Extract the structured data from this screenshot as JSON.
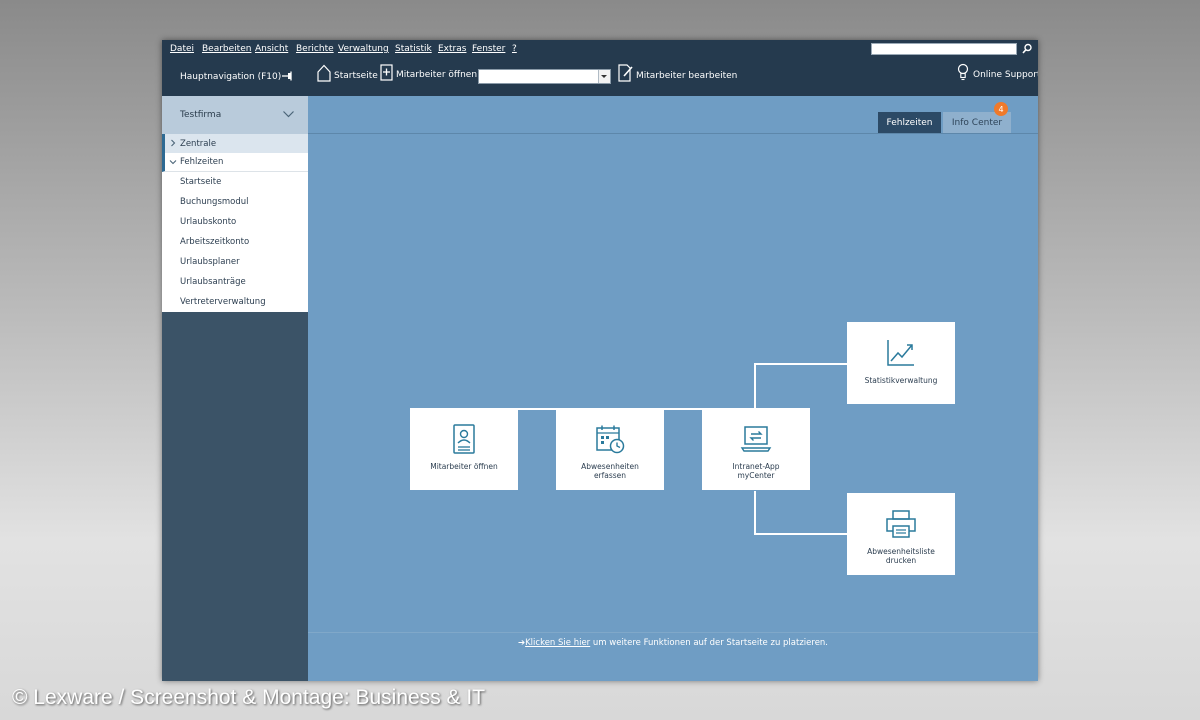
{
  "menubar": {
    "items": [
      "Datei",
      "Bearbeiten",
      "Ansicht",
      "Berichte",
      "Verwaltung",
      "Statistik",
      "Extras",
      "Fenster",
      "?"
    ],
    "search_value": ""
  },
  "toolbar": {
    "nav_label": "Hauptnavigation (F10)",
    "start_label": "Startseite",
    "open_employee_label": "Mitarbeiter öffnen",
    "employee_select_value": "",
    "edit_employee_label": "Mitarbeiter bearbeiten",
    "support_label": "Online Support"
  },
  "sidebar": {
    "company": "Testfirma",
    "sections": [
      "Zentrale",
      "Fehlzeiten"
    ],
    "items": [
      "Startseite",
      "Buchungsmodul",
      "Urlaubskonto",
      "Arbeitszeitkonto",
      "Urlaubsplaner",
      "Urlaubsanträge",
      "Vertreterverwaltung"
    ]
  },
  "tabs": {
    "active": "Fehlzeiten",
    "info": "Info Center",
    "info_badge": "4"
  },
  "tiles": {
    "open_employee": "Mitarbeiter öffnen",
    "record_absences": "Abwesenheiten\nerfassen",
    "intranet_app": "Intranet-App\nmyCenter",
    "statistics": "Statistikverwaltung",
    "print_absences": "Abwesenheitsliste\ndrucken"
  },
  "hint": {
    "link": "Klicken Sie hier",
    "rest": " um weitere Funktionen auf der Startseite zu platzieren."
  },
  "copyright": "© Lexware / Screenshot & Montage: Business & IT",
  "colors": {
    "titlebar": "#253a4e",
    "sidebar": "#3b5367",
    "main": "#6f9dc4",
    "icon": "#2a7a9c",
    "badge": "#ef7a2b"
  }
}
